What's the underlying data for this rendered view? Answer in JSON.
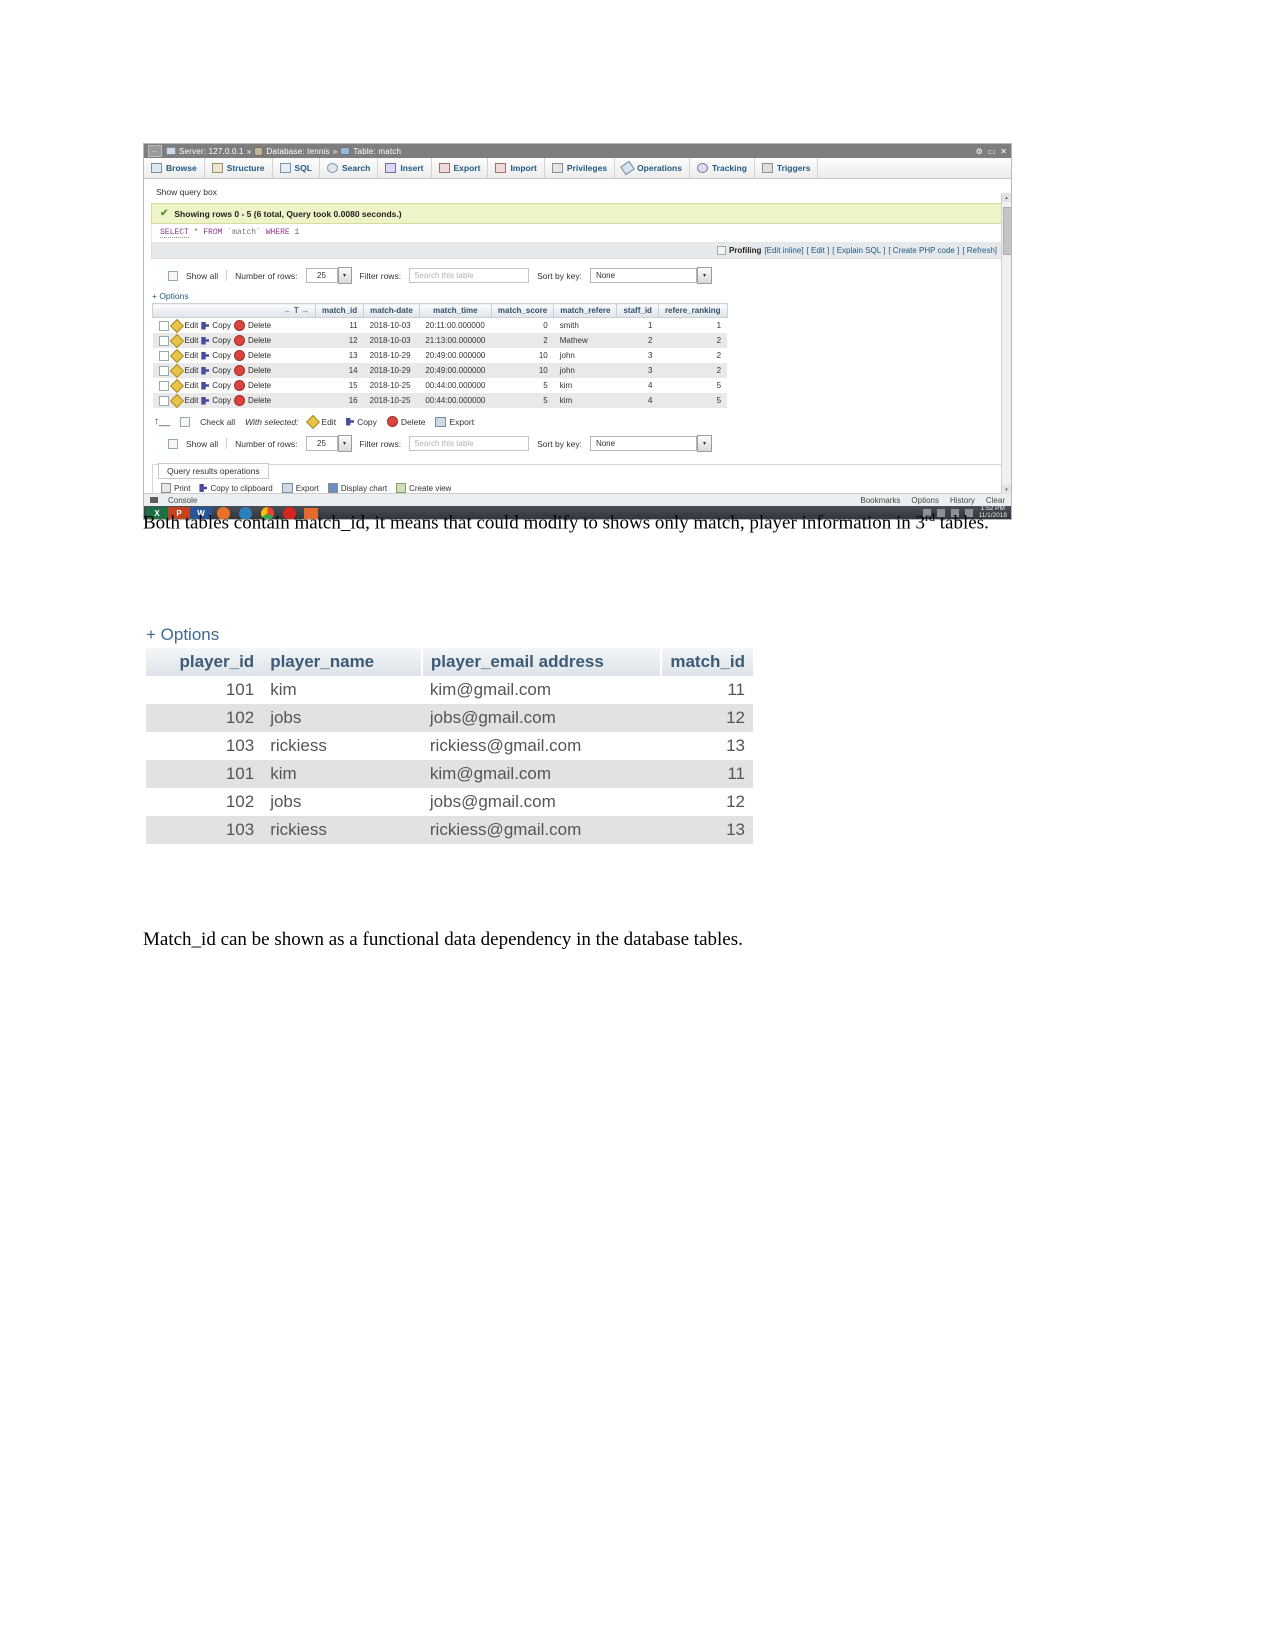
{
  "screenshot": {
    "titlebar": {
      "back_label": "←",
      "crumb_server": "Server: 127.0.0.1",
      "sep1": "»",
      "crumb_database": "Database: tennis",
      "sep2": "»",
      "crumb_table": "Table: match",
      "gear_icon": "gear-icon",
      "minimize": "▭",
      "close": "✕"
    },
    "tabs": [
      {
        "label": "Browse",
        "key": "browse"
      },
      {
        "label": "Structure",
        "key": "structure"
      },
      {
        "label": "SQL",
        "key": "sql"
      },
      {
        "label": "Search",
        "key": "search"
      },
      {
        "label": "Insert",
        "key": "insert"
      },
      {
        "label": "Export",
        "key": "export"
      },
      {
        "label": "Import",
        "key": "import"
      },
      {
        "label": "Privileges",
        "key": "privileges"
      },
      {
        "label": "Operations",
        "key": "operations"
      },
      {
        "label": "Tracking",
        "key": "tracking"
      },
      {
        "label": "Triggers",
        "key": "triggers"
      }
    ],
    "show_query_box": "Show query box",
    "notice": "Showing rows 0 - 5 (6 total, Query took 0.0080 seconds.)",
    "sql": {
      "select": "SELECT",
      "star": "*",
      "from": "FROM",
      "table": "`match`",
      "where": "WHERE",
      "one": "1"
    },
    "profiling": {
      "label": "Profiling",
      "edit_inline": "[Edit inline]",
      "edit": "[ Edit ]",
      "explain_sql": "[ Explain SQL ]",
      "create_php": "[ Create PHP code ]",
      "refresh": "[ Refresh]"
    },
    "controls": {
      "show_all": "Show all",
      "number_of_rows_label": "Number of rows:",
      "number_of_rows_value": "25",
      "filter_rows_label": "Filter rows:",
      "filter_rows_placeholder": "Search this table",
      "sort_by_key_label": "Sort by key:",
      "sort_by_key_value": "None"
    },
    "options_link": "+ Options",
    "table": {
      "sort_glyph": "← T →",
      "columns": [
        "match_id",
        "match-date",
        "match_time",
        "match_score",
        "match_refere",
        "staff_id",
        "refere_ranking"
      ],
      "row_actions": [
        "Edit",
        "Copy",
        "Delete"
      ],
      "rows": [
        {
          "match_id": "11",
          "match_date": "2018-10-03",
          "match_time": "20:11:00.000000",
          "match_score": "0",
          "match_refere": "smith",
          "staff_id": "1",
          "refere_ranking": "1"
        },
        {
          "match_id": "12",
          "match_date": "2018-10-03",
          "match_time": "21:13:00.000000",
          "match_score": "2",
          "match_refere": "Mathew",
          "staff_id": "2",
          "refere_ranking": "2"
        },
        {
          "match_id": "13",
          "match_date": "2018-10-29",
          "match_time": "20:49:00.000000",
          "match_score": "10",
          "match_refere": "john",
          "staff_id": "3",
          "refere_ranking": "2"
        },
        {
          "match_id": "14",
          "match_date": "2018-10-29",
          "match_time": "20:49:00.000000",
          "match_score": "10",
          "match_refere": "john",
          "staff_id": "3",
          "refere_ranking": "2"
        },
        {
          "match_id": "15",
          "match_date": "2018-10-25",
          "match_time": "00:44:00.000000",
          "match_score": "5",
          "match_refere": "kim",
          "staff_id": "4",
          "refere_ranking": "5"
        },
        {
          "match_id": "16",
          "match_date": "2018-10-25",
          "match_time": "00:44:00.000000",
          "match_score": "5",
          "match_refere": "kim",
          "staff_id": "4",
          "refere_ranking": "5"
        }
      ]
    },
    "with_selected": {
      "check_all": "Check all",
      "label": "With selected:",
      "edit": "Edit",
      "copy": "Copy",
      "delete": "Delete",
      "export": "Export"
    },
    "query_results_operations": {
      "legend": "Query results operations",
      "print": "Print",
      "copy_to_clipboard": "Copy to clipboard",
      "export": "Export",
      "display_chart": "Display chart",
      "create_view": "Create view"
    },
    "statusbar": {
      "console": "Console",
      "bookmarks": "Bookmarks",
      "options": "Options",
      "history": "History",
      "clear": "Clear"
    },
    "taskbar": {
      "items": [
        "X",
        "P",
        "W",
        "firefox-icon",
        "edge-icon",
        "chrome-icon",
        "opera-icon",
        "mail-icon"
      ],
      "time": "1:52 PM",
      "date": "11/1/2018"
    }
  },
  "document": {
    "paragraph1_lead": "Both",
    "paragraph1_rest": "tables contain match_id, it means that could modify to shows only match, player information in 3",
    "paragraph1_sup": "rd",
    "paragraph1_tail": " tables.",
    "paragraph2": "Match_id can be shown as a functional data dependency in the database tables."
  },
  "player_table": {
    "options_link": "+ Options",
    "columns": [
      "player_id",
      "player_name",
      "player_email address",
      "match_id"
    ],
    "rows": [
      {
        "player_id": "101",
        "player_name": "kim",
        "player_email": "kim@gmail.com",
        "match_id": "11"
      },
      {
        "player_id": "102",
        "player_name": "jobs",
        "player_email": "jobs@gmail.com",
        "match_id": "12"
      },
      {
        "player_id": "103",
        "player_name": "rickiess",
        "player_email": "rickiess@gmail.com",
        "match_id": "13"
      },
      {
        "player_id": "101",
        "player_name": "kim",
        "player_email": "kim@gmail.com",
        "match_id": "11"
      },
      {
        "player_id": "102",
        "player_name": "jobs",
        "player_email": "jobs@gmail.com",
        "match_id": "12"
      },
      {
        "player_id": "103",
        "player_name": "rickiess",
        "player_email": "rickiess@gmail.com",
        "match_id": "13"
      }
    ]
  }
}
